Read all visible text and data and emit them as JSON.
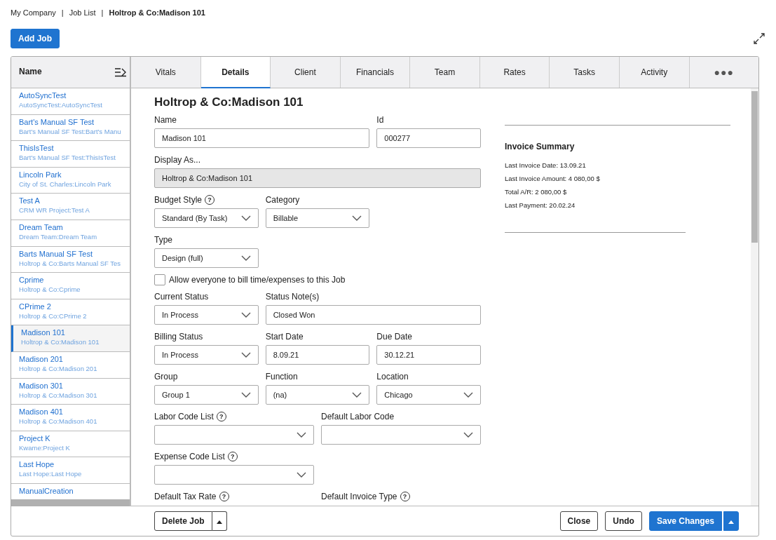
{
  "breadcrumb": {
    "separator": "|",
    "items": [
      {
        "label": "My Company",
        "current": false
      },
      {
        "label": "Job List",
        "current": false
      },
      {
        "label": "Holtrop & Co:Madison 101",
        "current": true
      }
    ]
  },
  "add_button": "Add Job",
  "sidebar": {
    "header": "Name",
    "items": [
      {
        "title": "AutoSyncTest",
        "subtitle": "AutoSyncTest:AutoSyncTest",
        "selected": false
      },
      {
        "title": "Bart's Manual SF Test",
        "subtitle": "Bart's Manual SF Test:Bart's Manu",
        "selected": false
      },
      {
        "title": "ThisIsTest",
        "subtitle": "Bart's Manual SF Test:ThisIsTest",
        "selected": false
      },
      {
        "title": "Lincoln Park",
        "subtitle": "City of St. Charles:Lincoln Park",
        "selected": false
      },
      {
        "title": "Test A",
        "subtitle": "CRM WR Project:Test A",
        "selected": false
      },
      {
        "title": "Dream Team",
        "subtitle": "Dream Team:Dream Team",
        "selected": false
      },
      {
        "title": "Barts Manual SF Test",
        "subtitle": "Holtrop & Co:Barts Manual SF Tes",
        "selected": false
      },
      {
        "title": "Cprime",
        "subtitle": "Holtrop & Co:Cprime",
        "selected": false
      },
      {
        "title": "CPrime 2",
        "subtitle": "Holtrop & Co:CPrime 2",
        "selected": false
      },
      {
        "title": "Madison 101",
        "subtitle": "Holtrop & Co:Madison 101",
        "selected": true
      },
      {
        "title": "Madison 201",
        "subtitle": "Holtrop & Co:Madison 201",
        "selected": false
      },
      {
        "title": "Madison 301",
        "subtitle": "Holtrop & Co:Madison 301",
        "selected": false
      },
      {
        "title": "Madison 401",
        "subtitle": "Holtrop & Co:Madison 401",
        "selected": false
      },
      {
        "title": "Project K",
        "subtitle": "Kwame:Project K",
        "selected": false
      },
      {
        "title": "Last Hope",
        "subtitle": "Last Hope:Last Hope",
        "selected": false
      },
      {
        "title": "ManualCreation",
        "selected": false
      }
    ]
  },
  "tabs": [
    {
      "label": "Vitals",
      "selected": false
    },
    {
      "label": "Details",
      "selected": true
    },
    {
      "label": "Client",
      "selected": false
    },
    {
      "label": "Financials",
      "selected": false
    },
    {
      "label": "Team",
      "selected": false
    },
    {
      "label": "Rates",
      "selected": false
    },
    {
      "label": "Tasks",
      "selected": false
    },
    {
      "label": "Activity",
      "selected": false
    },
    {
      "label": "●●●",
      "selected": false
    }
  ],
  "form": {
    "title": "Holtrop & Co:Madison 101",
    "rows": [
      [
        {
          "kind": "text",
          "label": "Name",
          "value": "Madison 101"
        },
        {
          "kind": "text",
          "label": "Id",
          "value": "000277"
        }
      ],
      [
        {
          "kind": "readonly",
          "label": "Display As...",
          "value": "Holtrop & Co:Madison 101"
        }
      ],
      [
        {
          "kind": "select",
          "label": "Budget Style",
          "help": "?",
          "value": "Standard (By Task)"
        },
        {
          "kind": "select",
          "label": "Category",
          "value": "Billable"
        }
      ],
      [
        {
          "kind": "select",
          "label": "Type",
          "value": "Design (full)"
        }
      ],
      [
        {
          "kind": "checkbox",
          "label": "Allow everyone to bill time/expenses to this Job",
          "checked": false
        }
      ],
      [
        {
          "kind": "select",
          "label": "Current Status",
          "value": "In Process"
        },
        {
          "kind": "text",
          "label": "Status Note(s)",
          "value": "Closed Won"
        }
      ],
      [
        {
          "kind": "select",
          "label": "Billing Status",
          "value": "In Process"
        },
        {
          "kind": "text",
          "label": "Start Date",
          "value": "8.09.21"
        },
        {
          "kind": "text",
          "label": "Due Date",
          "value": "30.12.21"
        }
      ],
      [
        {
          "kind": "select",
          "label": "Group",
          "value": "Group 1"
        },
        {
          "kind": "select",
          "label": "Function",
          "value": "(na)"
        },
        {
          "kind": "select",
          "label": "Location",
          "value": "Chicago"
        }
      ],
      [
        {
          "kind": "select",
          "label": "Labor Code List",
          "help": "?"
        },
        {
          "kind": "select",
          "label": "Default Labor Code"
        }
      ],
      [
        {
          "kind": "select",
          "label": "Expense Code List",
          "help": "?"
        }
      ],
      [
        {
          "kind": "label",
          "label": "Default Tax Rate",
          "help": "?"
        },
        {
          "kind": "label",
          "label": "Default Invoice Type",
          "help": "?"
        }
      ]
    ]
  },
  "invoice_summary": {
    "title": "Invoice Summary",
    "lines": [
      "Last Invoice Date: 13.09.21",
      "Last Invoice Amount: 4 080,00 $",
      "Total A/R: 2 080,00 $",
      "Last Payment: 20.02.24"
    ]
  },
  "footer": {
    "delete_button": "Delete Job",
    "close_button": "Close",
    "undo_button": "Undo",
    "save_button": "Save Changes"
  }
}
